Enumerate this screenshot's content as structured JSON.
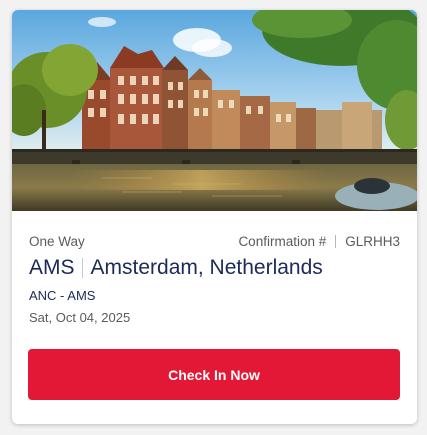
{
  "card": {
    "hero_image": "amsterdam-canal-photo",
    "trip_type": "One Way",
    "confirmation_label": "Confirmation #",
    "confirmation_code": "GLRHH3",
    "destination_code": "AMS",
    "destination_name": "Amsterdam, Netherlands",
    "route": "ANC - AMS",
    "date": "Sat, Oct 04, 2025",
    "check_in_label": "Check In Now"
  },
  "colors": {
    "brand_red": "#e31837",
    "navy_text": "#1b2a5a",
    "gray_text": "#5b5b5b"
  }
}
